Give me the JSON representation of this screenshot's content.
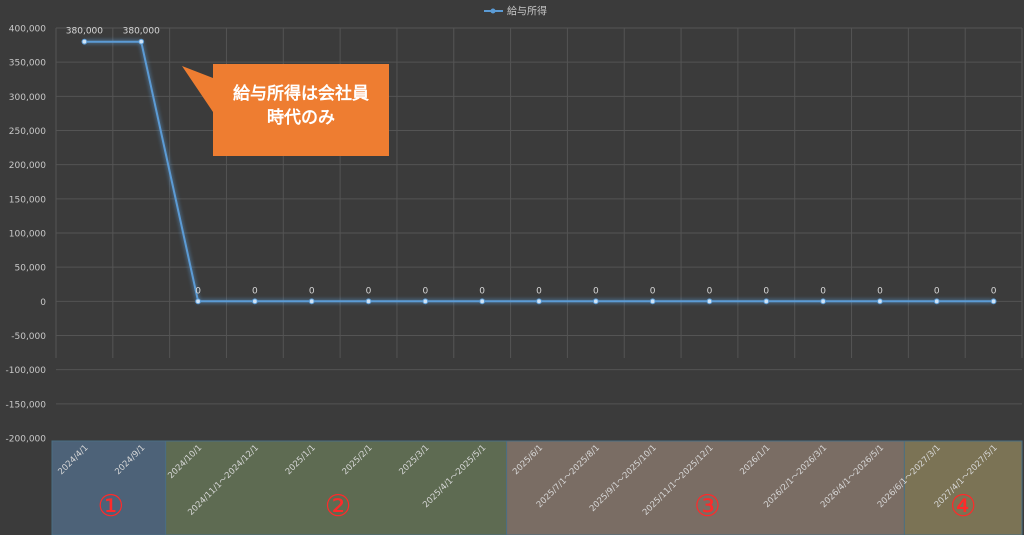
{
  "chart_data": {
    "type": "line",
    "legend": {
      "position": "top",
      "entries": [
        "給与所得"
      ]
    },
    "categories": [
      "2024/4/1",
      "2024/9/1",
      "2024/10/1",
      "2024/11/1～2024/12/1",
      "2025/1/1",
      "2025/2/1",
      "2025/3/1",
      "2025/4/1～2025/5/1",
      "2025/6/1",
      "2025/7/1～2025/8/1",
      "2025/9/1～2025/10/1",
      "2025/11/1～2025/12/1",
      "2026/1/1",
      "2026/2/1～2026/3/1",
      "2026/4/1～2026/5/1",
      "2026/6/1～2027/3/1",
      "2027/4/1～2027/5/1"
    ],
    "series": [
      {
        "name": "給与所得",
        "values": [
          380000,
          380000,
          0,
          0,
          0,
          0,
          0,
          0,
          0,
          0,
          0,
          0,
          0,
          0,
          0,
          0,
          0
        ],
        "labels": [
          "380,000",
          "380,000",
          "0",
          "0",
          "0",
          "0",
          "0",
          "0",
          "0",
          "0",
          "0",
          "0",
          "0",
          "0",
          "0",
          "0",
          "0"
        ]
      }
    ],
    "ylim": [
      -200000,
      400000
    ],
    "yticks": [
      "400,000",
      "350,000",
      "300,000",
      "250,000",
      "200,000",
      "150,000",
      "100,000",
      "50,000",
      "0",
      "-50,000",
      "-100,000",
      "-150,000",
      "-200,000"
    ],
    "grid": true,
    "callout": {
      "lines": [
        "給与所得は会社員",
        "時代のみ"
      ]
    },
    "phases": [
      {
        "label": "①",
        "start": 0,
        "end": 1,
        "color": "#4d6278"
      },
      {
        "label": "②",
        "start": 2,
        "end": 7,
        "color": "#5e6b52"
      },
      {
        "label": "③",
        "start": 8,
        "end": 14,
        "color": "#7a6d64"
      },
      {
        "label": "④",
        "start": 15,
        "end": 16,
        "color": "#7b7355"
      }
    ],
    "colors": {
      "line": "#5b9bd5",
      "phase_label": "#ff2a2a",
      "grid": "#545454",
      "text": "#c8c8c8"
    }
  }
}
